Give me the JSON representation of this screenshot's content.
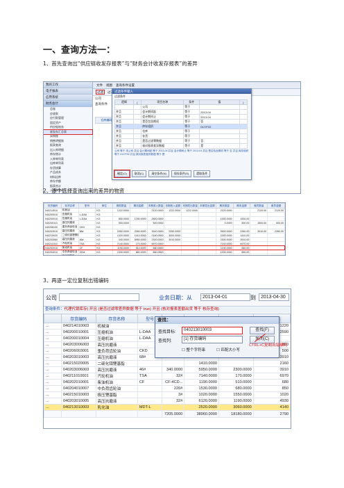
{
  "heading": "一、查询方法一：",
  "steps": {
    "s1": "1、首先查询出“供应链收发存报表”与“财务会计收发存报表”的差异",
    "s2": "2、逐个选择查询出来的差异的物资",
    "s3": "3、再逐一定位复制出错编码"
  },
  "shot1": {
    "tree_sections": [
      "我的工作",
      "电子报表",
      "应用系统"
    ],
    "tree_group": "财务会计",
    "tree_nodes": [
      "总账",
      "应收款",
      "应付款管理",
      "固定资产",
      "供应链账务",
      "收发存汇总表",
      "采购账",
      "销售明细账",
      "报表查询",
      "出入库明细",
      "库存统计",
      "入库单列表",
      "出库单列表",
      "存货核算",
      "产品成本",
      "材料出库",
      "库存余额",
      "报表合计",
      "入库单查询",
      "财务报表"
    ],
    "tree_highlight": "收发存汇总表",
    "menubar": [
      "文件",
      "视图",
      "查询条件设置"
    ],
    "toolbar": [
      "过滤",
      "过滤条件",
      "同比",
      "合并",
      "刷新",
      "打印",
      "退出"
    ],
    "toolbar_boxed": "过滤",
    "work_title": "公司",
    "work_sub": "查询条件",
    "grid_headers": [
      "仓库编码",
      "仓库名称",
      "存货编码"
    ],
    "dialog": {
      "title": "过滤条件输入",
      "hint": "过滤条件",
      "headers": [
        "逻辑",
        "(",
        "项目名称",
        "条件",
        "值",
        ")"
      ],
      "rows": [
        [
          "",
          "",
          "公司",
          "等于",
          "",
          ""
        ],
        [
          "并且",
          "",
          "会计期间起",
          "等于",
          "2013-04",
          ""
        ],
        [
          "并且",
          "",
          "会计期间止",
          "等于",
          "2013-04",
          ""
        ],
        [
          "并且",
          "",
          "是否包含期初",
          "等于",
          "否",
          ""
        ],
        [
          "并且",
          "",
          "库存组织",
          "等于",
          "DIJ7F02",
          ""
        ],
        [
          "并且",
          "",
          "仓库",
          "等于",
          "",
          ""
        ],
        [
          "并且",
          "",
          "存货",
          "等于",
          "",
          ""
        ],
        [
          "并且",
          "",
          "是否过滤零数据",
          "等于",
          "否",
          ""
        ],
        [
          "并且",
          "",
          "核对报表差异数据",
          "等于",
          "是",
          ""
        ]
      ],
      "highlight_row": 4,
      "note": "公司 等于 本公司 并且 会计期间起 等于 2013-04 并且 会计期间止 等于 2013-04 并且 是否包含期初 等于 否 并且 库存组织 等于 DIJ7F02 并且 核对报表差异数据 等于 是",
      "buttons": [
        "确定(O)",
        "取消(C)",
        "清空条件(N)",
        "保存条件(S)",
        "提取条件"
      ],
      "button_boxed": "确定(O)"
    }
  },
  "shot2": {
    "headers": [
      "存货编码",
      "存货名称",
      "型号",
      "单位",
      "期初数量",
      "期初金额",
      "本期收入数量",
      "本期收入金额",
      "本期发出数量",
      "本期发出金额",
      "期末数量",
      "期末金额",
      "差异数量",
      "差异金额"
    ],
    "rows": [
      [
        "040214010",
        "机械油",
        "",
        "KG",
        "1222.0000",
        "",
        "2120.0000",
        "1222.0000",
        "1222.0000",
        "",
        "2120.0000",
        "",
        "2120.00",
        "2120.00"
      ],
      [
        "040200010",
        "压缩机油",
        "L-DAA",
        "KG",
        "",
        "",
        "",
        "",
        "",
        "",
        "",
        "",
        "",
        ""
      ],
      [
        "040200010",
        "压缩机油",
        "L-DAA",
        "KG",
        "850.0000",
        "1780.0000",
        "2500.0000",
        "",
        "",
        "",
        "1530.0000",
        "1530.00",
        "",
        ""
      ],
      [
        "040200110",
        "高压抗磨液",
        "",
        "KG",
        "500.0000",
        "",
        "500.0000",
        "",
        "",
        "",
        "0.0000",
        "500.00",
        "1500.00",
        "500.00"
      ],
      [
        "040206100",
        "重负荷齿轮油",
        "CKD",
        "KG",
        "",
        "",
        "",
        "",
        "",
        "",
        "",
        "",
        "",
        ""
      ],
      [
        "040203010",
        "高压抗磨液",
        "68#",
        "KG",
        "2050.0000",
        "2280.0000",
        "3910.0000",
        "2050.0000",
        "",
        "",
        "5900.0000",
        "2280.00",
        "3910.00",
        "2280.00"
      ],
      [
        "040215020",
        "二硫化钼锂基脂",
        "",
        "KG",
        "1320.0000",
        "1410.0000",
        "2160.0000",
        "3000.0000",
        "",
        "",
        "2160.0000",
        "1410.00",
        "",
        ""
      ],
      [
        "040203060",
        "高压抗磨液",
        "46#",
        "KG",
        "340.0000",
        "5950.0000",
        "2300.0000",
        "3910.0000",
        "",
        "",
        "2300.0000",
        "3910.00",
        "",
        ""
      ],
      [
        "040211010",
        "汽轮机油",
        "TSA",
        "KG",
        "7140.0000",
        "170.0000",
        "6970.0000",
        "",
        "",
        "",
        "7140.0000",
        "6970.00",
        "",
        ""
      ],
      [
        "040202010",
        "柴油机油",
        "CF",
        "KG",
        "1190.0000",
        "510.0000",
        "680.0000",
        "",
        "",
        "",
        "1190.0000",
        "680.00",
        "",
        ""
      ],
      [
        "040204010",
        "中负荷齿轮油",
        "220#",
        "KG",
        "1530.0000",
        "680.0000",
        "850.0000",
        "",
        "",
        "",
        "1530.0000",
        "850.00",
        "",
        ""
      ],
      [
        "040215010",
        "极压锂基脂",
        "3#",
        "KG",
        "1020.0000",
        "1550.0000",
        "1020.0000",
        "1550.0000",
        "",
        "",
        "1020.0000",
        "1550.00",
        "",
        ""
      ],
      [
        "040213010",
        "乳化油",
        "MDT-L",
        "KG",
        "2520.0000",
        "3060.0000",
        "4140.0000",
        "2340.0000",
        "",
        "",
        "2520.0000",
        "4140.00",
        "2340.00",
        "4140.00"
      ]
    ],
    "highlight_row": 12
  },
  "shot3": {
    "company_label": "公司",
    "date_label": "业务日期：从",
    "date_from": "2013-04-01",
    "to_label": "到",
    "date_to": "2013-04-30",
    "condition_prefix": "查询条件：",
    "condition_text": "代理代销库存) 开且 (是否过滤零差异数据 等于 true) 开且 (核对报表差额出货 等于 核存查询)",
    "headers": [
      "存货编码",
      "存货名称",
      "型号",
      "规格",
      "数量",
      "金额"
    ],
    "right_header": "库存标准",
    "rows": [
      [
        "040214010003",
        "机械油",
        "",
        "",
        "",
        "",
        "1220"
      ],
      [
        "040200010001",
        "压缩机油",
        "L-DAA",
        "",
        "",
        "",
        "2590"
      ],
      [
        "040200010004",
        "压缩机油",
        "L-DAA",
        "",
        "",
        "",
        ""
      ],
      [
        "040203006003",
        "高压抗磨液",
        "",
        "",
        "",
        "",
        "850"
      ],
      [
        "040206003001",
        "重负荷齿轮油",
        "CKD",
        "",
        "",
        "",
        "500"
      ],
      [
        "040203010003",
        "高压抗磨液",
        "68#",
        "",
        "2050.0000",
        "2280.0000",
        "3910"
      ],
      [
        "040215020005",
        "二硫化钼锂基脂",
        "",
        "",
        "1410.0000",
        "",
        "2160"
      ],
      [
        "040203006003",
        "高压抗磨液",
        "46#",
        "340.0000",
        "5950.0000",
        "2300.0000",
        "3910"
      ],
      [
        "040211010001",
        "汽轮机油",
        "TSA",
        "32#",
        "7140.0000",
        "170.0000",
        "6970"
      ],
      [
        "040202010001",
        "柴油机油",
        "CF",
        "CF-4CD...",
        "1190.0000",
        "510.0000",
        "680"
      ],
      [
        "040204010007",
        "中负荷齿轮油",
        "",
        "220#",
        "1530.0000",
        "680.0000",
        "850"
      ],
      [
        "040215010003",
        "极压锂基脂",
        "",
        "3#",
        "1020.0000",
        "1550.0000",
        "1020"
      ],
      [
        "040203010005",
        "高压抗磨液",
        "",
        "32#",
        "6120.0000",
        "1190.0000",
        "4930"
      ],
      [
        "040213010003",
        "乳化油",
        "MDT-L",
        "",
        "2520.0000",
        "3060.0000",
        "4140"
      ]
    ],
    "selected_row": 13,
    "totals": [
      "7205.0000",
      "38960.0000",
      "18180.0000",
      "2790"
    ],
    "find": {
      "title": "查找：",
      "target_label": "查找目标:",
      "target_value": "040213010003",
      "column_label": "查找列:",
      "column_value": "[1] 存货编码",
      "find_button": "查找(F)",
      "close_button": "关闭(C)",
      "chk_whole": "整个字符串",
      "chk_case": "匹配大小写"
    },
    "annotation": "CTRL+C复制出错编码"
  }
}
